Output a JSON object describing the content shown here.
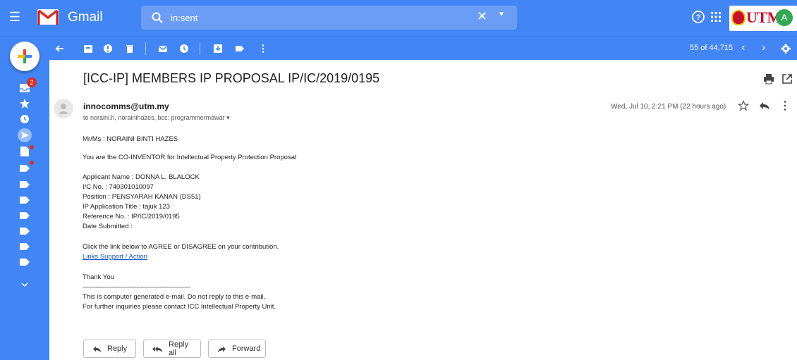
{
  "app": {
    "name": "Gmail",
    "search_value": "in:sent",
    "brand_color": "#4285f4",
    "avatar_letter": "A",
    "utm_label": "UTM"
  },
  "toolbar": {
    "counter": "55 of 44,715",
    "icons": [
      "back-arrow-icon",
      "archive-icon",
      "report-spam-icon",
      "delete-icon",
      "mark-unread-icon",
      "snooze-icon",
      "move-to-icon",
      "labels-icon",
      "more-vert-icon"
    ]
  },
  "rail": {
    "inbox_badge": "2",
    "icons": [
      "inbox-icon",
      "starred-icon",
      "snoozed-icon",
      "sent-icon",
      "drafts-icon",
      "label-icon",
      "label-icon",
      "label-icon",
      "label-icon",
      "label-icon",
      "label-icon",
      "label-icon",
      "expand-more-icon"
    ]
  },
  "email": {
    "subject": "[ICC-IP] MEMBERS IP PROPOSAL IP/IC/2019/0195",
    "sender": "innocomms@utm.my",
    "recipients": "to noraini.h, norainihazes, bcc: programmermawar",
    "date": "Wed, Jul 10, 2:21 PM (22 hours ago)",
    "body": {
      "greeting": "Mr/Ms : NORAINI BINTI HAZES",
      "intro": "You are the CO-INVENTOR for Intellectual Property Protection Proposal",
      "applicant": "Applicant Name : DONNA L. BLALOCK",
      "ic_no": "I/C No. : 740301010097",
      "position": "Position : PENSYARAH KANAN (DS51)",
      "app_title": "IP Application Title : tajuk 123",
      "reference": "Reference No. : IP/IC/2019/0195",
      "date_submitted": "Date Submitted :",
      "instruction": "Click the link below to AGREE or DISAGREE on your contribution.",
      "link": "Links Support / Action",
      "thanks": "Thank You",
      "divider": "--------------------------------------------------------------------------",
      "footer1": "This is computer generated e-mail. Do not reply to this e-mail.",
      "footer2": "For further inquiries please contact ICC Intellectual Property Unit."
    }
  },
  "actions": {
    "reply": "Reply",
    "reply_all": "Reply all",
    "forward": "Forward"
  }
}
